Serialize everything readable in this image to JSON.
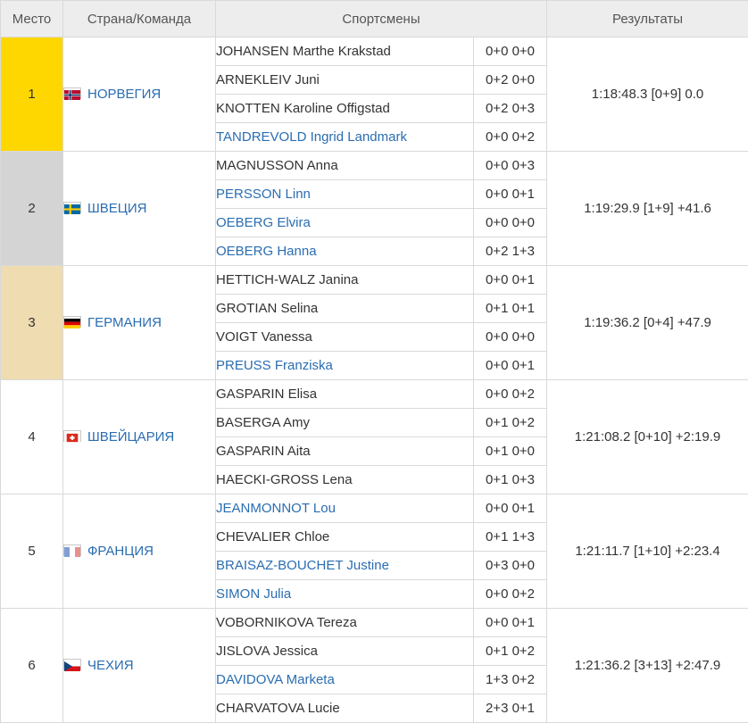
{
  "headers": {
    "place": "Место",
    "country": "Страна/Команда",
    "athletes": "Спортсмены",
    "results": "Результаты"
  },
  "colors": {
    "gold": "#ffd700",
    "silver": "#d4d4d4",
    "bronze": "#efdcb0",
    "link": "#2a6db1"
  },
  "teams": [
    {
      "place": "1",
      "country": "НОРВЕГИЯ",
      "flag": "flag-norway-icon",
      "result": "1:18:48.3 [0+9] 0.0",
      "athletes": [
        {
          "name": "JOHANSEN Marthe Krakstad",
          "shooting": "0+0 0+0",
          "link": false
        },
        {
          "name": "ARNEKLEIV Juni",
          "shooting": "0+2 0+0",
          "link": false
        },
        {
          "name": "KNOTTEN Karoline Offigstad",
          "shooting": "0+2 0+3",
          "link": false
        },
        {
          "name": "TANDREVOLD Ingrid Landmark",
          "shooting": "0+0 0+2",
          "link": true
        }
      ]
    },
    {
      "place": "2",
      "country": "ШВЕЦИЯ",
      "flag": "flag-sweden-icon",
      "result": "1:19:29.9 [1+9] +41.6",
      "athletes": [
        {
          "name": "MAGNUSSON Anna",
          "shooting": "0+0 0+3",
          "link": false
        },
        {
          "name": "PERSSON Linn",
          "shooting": "0+0 0+1",
          "link": true
        },
        {
          "name": "OEBERG Elvira",
          "shooting": "0+0 0+0",
          "link": true
        },
        {
          "name": "OEBERG Hanna",
          "shooting": "0+2 1+3",
          "link": true
        }
      ]
    },
    {
      "place": "3",
      "country": "ГЕРМАНИЯ",
      "flag": "flag-germany-icon",
      "result": "1:19:36.2 [0+4] +47.9",
      "athletes": [
        {
          "name": "HETTICH-WALZ Janina",
          "shooting": "0+0 0+1",
          "link": false
        },
        {
          "name": "GROTIAN Selina",
          "shooting": "0+1 0+1",
          "link": false
        },
        {
          "name": "VOIGT Vanessa",
          "shooting": "0+0 0+0",
          "link": false
        },
        {
          "name": "PREUSS Franziska",
          "shooting": "0+0 0+1",
          "link": true
        }
      ]
    },
    {
      "place": "4",
      "country": "ШВЕЙЦАРИЯ",
      "flag": "flag-switzerland-icon",
      "result": "1:21:08.2 [0+10] +2:19.9",
      "athletes": [
        {
          "name": "GASPARIN Elisa",
          "shooting": "0+0 0+2",
          "link": false
        },
        {
          "name": "BASERGA Amy",
          "shooting": "0+1 0+2",
          "link": false
        },
        {
          "name": "GASPARIN Aita",
          "shooting": "0+1 0+0",
          "link": false
        },
        {
          "name": "HAECKI-GROSS Lena",
          "shooting": "0+1 0+3",
          "link": false
        }
      ]
    },
    {
      "place": "5",
      "country": "ФРАНЦИЯ",
      "flag": "flag-france-icon",
      "result": "1:21:11.7 [1+10] +2:23.4",
      "athletes": [
        {
          "name": "JEANMONNOT Lou",
          "shooting": "0+0 0+1",
          "link": true
        },
        {
          "name": "CHEVALIER Chloe",
          "shooting": "0+1 1+3",
          "link": false
        },
        {
          "name": "BRAISAZ-BOUCHET Justine",
          "shooting": "0+3 0+0",
          "link": true
        },
        {
          "name": "SIMON Julia",
          "shooting": "0+0 0+2",
          "link": true
        }
      ]
    },
    {
      "place": "6",
      "country": "ЧЕХИЯ",
      "flag": "flag-czechia-icon",
      "result": "1:21:36.2 [3+13] +2:47.9",
      "athletes": [
        {
          "name": "VOBORNIKOVA Tereza",
          "shooting": "0+0 0+1",
          "link": false
        },
        {
          "name": "JISLOVA Jessica",
          "shooting": "0+1 0+2",
          "link": false
        },
        {
          "name": "DAVIDOVA Marketa",
          "shooting": "1+3 0+2",
          "link": true
        },
        {
          "name": "CHARVATOVA Lucie",
          "shooting": "2+3 0+1",
          "link": false
        }
      ]
    }
  ]
}
